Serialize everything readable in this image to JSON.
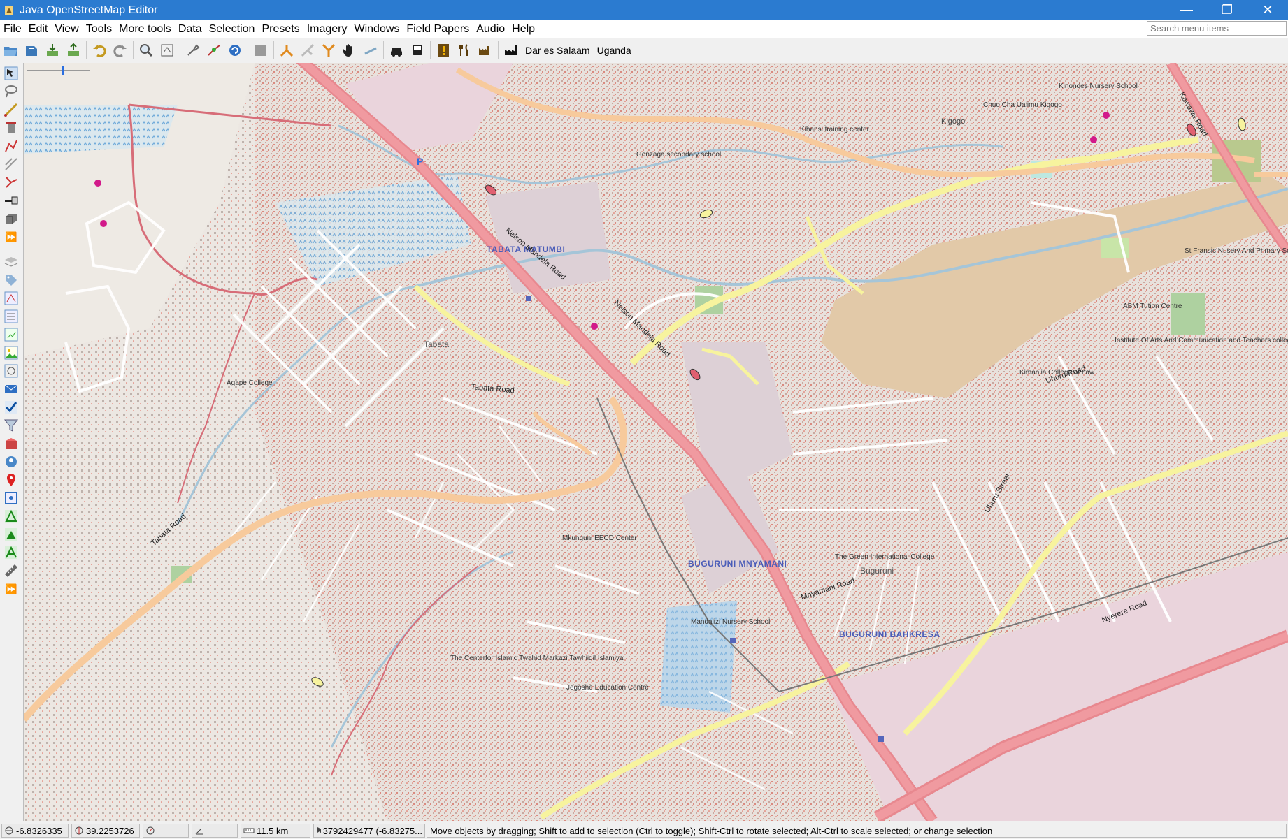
{
  "window": {
    "title": "Java OpenStreetMap Editor",
    "minimize": "—",
    "maximize": "❐",
    "close": "✕"
  },
  "menubar": {
    "items": [
      "File",
      "Edit",
      "View",
      "Tools",
      "More tools",
      "Data",
      "Selection",
      "Presets",
      "Imagery",
      "Windows",
      "Field Papers",
      "Audio",
      "Help"
    ],
    "search_placeholder": "Search menu items"
  },
  "toolbar": {
    "preset_1": "Dar es Salaam",
    "preset_2": "Uganda"
  },
  "map": {
    "places": {
      "tabata_matumbi": "TABATA MATUMBI",
      "buguruni_mnyamani": "BUGURUNI MNYAMANI",
      "buguruni_bahkresa": "BUGURUNI BAHKRESA",
      "tabata": "Tabata",
      "buguruni": "Buguruni",
      "kigogo": "Kigogo"
    },
    "roads": {
      "nelson_mandela_1": "Nelson Mandela Road",
      "nelson_mandela_2": "Nelson Mandela Road",
      "tabata_road_1": "Tabata Road",
      "tabata_road_2": "Tabata Road",
      "uhuru_road": "Uhuru Road",
      "uhuru_street": "Uhuru Street",
      "nyerere_road": "Nyerere Road",
      "kawawa_road": "Kawawa Road",
      "mnyamani_road": "Mnyamani Road"
    },
    "pois": {
      "gonzaga": "Gonzaga secondary school",
      "kihansi": "Kihansi training center",
      "kinondes": "Kinondes Nursery School",
      "chuo": "Chuo Cha Ualimu Kigogo",
      "agape": "Agape College",
      "mkunguni": "Mkunguni EECD Center",
      "green_intl": "The Green International College",
      "mandalizi": "Mandalizi Nursery School",
      "islamic": "The Centerfor Islamic Twahid Markazi Tawhiidil Islamiya",
      "jegoshe": "Jegoshe Education Centre",
      "abm": "ABM Tution Centre",
      "institute": "Institute Of Arts And Communication and Teachers college",
      "kimanjia": "Kimanjia College of Law",
      "st_fransic": "St Fransic Nusery And Primary Sc"
    },
    "parking_symbol": "P"
  },
  "statusbar": {
    "lat": "-6.8326335",
    "lon": "39.2253726",
    "distance": "11.5 km",
    "node": "3792429477 (-6.83275...",
    "message": "Move objects by dragging; Shift to add to selection (Ctrl to toggle); Shift-Ctrl to rotate selected; Alt-Ctrl to scale selected; or change selection"
  }
}
